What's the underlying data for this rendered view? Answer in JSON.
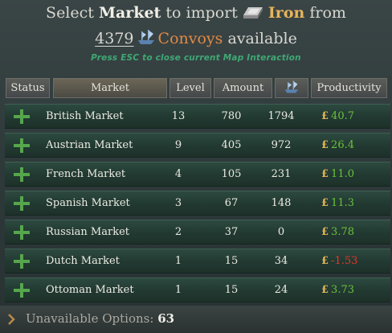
{
  "header": {
    "line1": {
      "select": "Select",
      "market": "Market",
      "to_import": "to import",
      "good": "Iron",
      "from": "from"
    },
    "line2": {
      "count": "4379",
      "convoys": "Convoys",
      "available": "available"
    },
    "hint": "Press ESC to close current Map Interaction"
  },
  "columns": {
    "status": "Status",
    "market": "Market",
    "level": "Level",
    "amount": "Amount",
    "convoys_icon": "convoy-ship-icon",
    "productivity": "Productivity"
  },
  "currency_symbol": "£",
  "rows": [
    {
      "market": "British Market",
      "level": "13",
      "amount": "780",
      "convoys": "1794",
      "productivity": "40.7",
      "sign": "positive"
    },
    {
      "market": "Austrian Market",
      "level": "9",
      "amount": "405",
      "convoys": "972",
      "productivity": "26.4",
      "sign": "positive"
    },
    {
      "market": "French Market",
      "level": "4",
      "amount": "105",
      "convoys": "231",
      "productivity": "11.0",
      "sign": "positive"
    },
    {
      "market": "Spanish Market",
      "level": "3",
      "amount": "67",
      "convoys": "148",
      "productivity": "11.3",
      "sign": "positive"
    },
    {
      "market": "Russian Market",
      "level": "2",
      "amount": "37",
      "convoys": "0",
      "productivity": "3.78",
      "sign": "positive"
    },
    {
      "market": "Dutch Market",
      "level": "1",
      "amount": "15",
      "convoys": "34",
      "productivity": "-1.53",
      "sign": "negative"
    },
    {
      "market": "Ottoman Market",
      "level": "1",
      "amount": "15",
      "convoys": "24",
      "productivity": "3.73",
      "sign": "positive"
    }
  ],
  "footer": {
    "label": "Unavailable Options:",
    "count": "63"
  },
  "colors": {
    "positive": "#6cc23c",
    "negative": "#e0392c",
    "gold": "#e3b457",
    "plus": "#56a64c"
  }
}
